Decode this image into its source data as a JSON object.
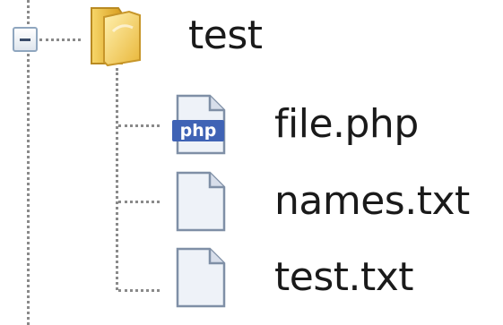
{
  "tree": {
    "root": {
      "label": "test",
      "icon": "folder-icon",
      "expanded": true,
      "toggle_icon": "collapse-minus-icon"
    },
    "children": [
      {
        "label": "file.php",
        "icon": "php-file-icon",
        "icon_text": "php"
      },
      {
        "label": "names.txt",
        "icon": "text-file-icon"
      },
      {
        "label": "test.txt",
        "icon": "text-file-icon"
      }
    ]
  },
  "colors": {
    "connector": "#8a8a8a",
    "folder": "#f2c94c",
    "php_badge": "#3f63b5",
    "text": "#1a1a1a"
  }
}
